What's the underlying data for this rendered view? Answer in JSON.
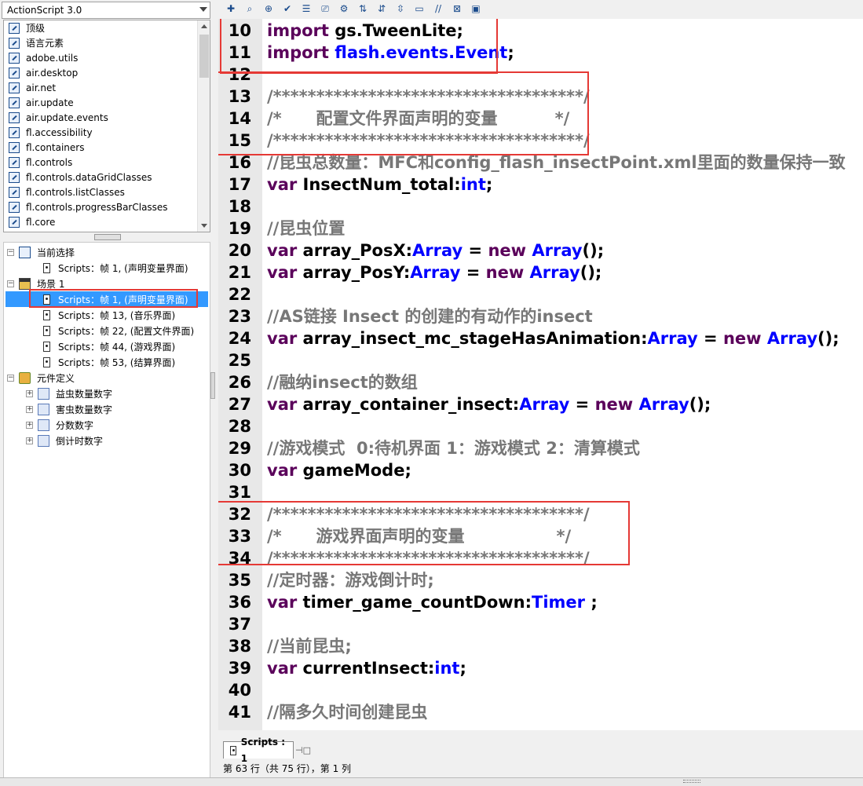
{
  "left_panel": {
    "dropdown_value": "ActionScript 3.0",
    "library_items": [
      "顶级",
      "语言元素",
      "adobe.utils",
      "air.desktop",
      "air.net",
      "air.update",
      "air.update.events",
      "fl.accessibility",
      "fl.containers",
      "fl.controls",
      "fl.controls.dataGridClasses",
      "fl.controls.listClasses",
      "fl.controls.progressBarClasses",
      "fl.core"
    ],
    "tree": {
      "current_selection": "当前选择",
      "current_script": "Scripts：帧 1, (声明变量界面)",
      "scene": "场景 1",
      "scene_scripts": [
        "Scripts：帧 1, (声明变量界面)",
        "Scripts：帧 13, (音乐界面)",
        "Scripts：帧 22, (配置文件界面)",
        "Scripts：帧 44, (游戏界面)",
        "Scripts：帧 53, (结算界面)"
      ],
      "symbol_definitions": "元件定义",
      "symbols": [
        "益虫数量数字",
        "害虫数量数字",
        "分数数字",
        "倒计时数字"
      ]
    }
  },
  "toolbar": {
    "icons": [
      "add-script-icon",
      "find-icon",
      "target-icon",
      "check-syntax-icon",
      "auto-format-icon",
      "code-hint-icon",
      "debug-icon",
      "collapse-icon",
      "collapse-selection-icon",
      "expand-icon",
      "block-comment-icon",
      "line-comment-icon",
      "remove-comment-icon",
      "show-toolbox-icon"
    ]
  },
  "editor": {
    "lines": [
      {
        "n": "10",
        "tokens": [
          [
            "kw",
            "import "
          ],
          [
            "id",
            "gs.TweenLite;"
          ]
        ]
      },
      {
        "n": "11",
        "tokens": [
          [
            "kw",
            "import "
          ],
          [
            "ty",
            "flash.events.Event"
          ],
          [
            "id",
            ";"
          ]
        ]
      },
      {
        "n": "12",
        "tokens": []
      },
      {
        "n": "13",
        "tokens": [
          [
            "cm",
            "/************************************/"
          ]
        ]
      },
      {
        "n": "14",
        "tokens": [
          [
            "cm",
            "/*      配置文件界面声明的变量          */"
          ]
        ]
      },
      {
        "n": "15",
        "tokens": [
          [
            "cm",
            "/************************************/"
          ]
        ]
      },
      {
        "n": "16",
        "tokens": [
          [
            "cm",
            "//昆虫总数量：MFC和config_flash_insectPoint.xml里面的数量保持一致"
          ]
        ]
      },
      {
        "n": "17",
        "tokens": [
          [
            "kw",
            "var "
          ],
          [
            "id",
            "InsectNum_total:"
          ],
          [
            "ty",
            "int"
          ],
          [
            "id",
            ";"
          ]
        ]
      },
      {
        "n": "18",
        "tokens": []
      },
      {
        "n": "19",
        "tokens": [
          [
            "cm",
            "//昆虫位置"
          ]
        ]
      },
      {
        "n": "20",
        "tokens": [
          [
            "kw",
            "var "
          ],
          [
            "id",
            "array_PosX:"
          ],
          [
            "ty",
            "Array"
          ],
          [
            "id",
            " = "
          ],
          [
            "kw",
            "new "
          ],
          [
            "ty",
            "Array"
          ],
          [
            "id",
            "();"
          ]
        ]
      },
      {
        "n": "21",
        "tokens": [
          [
            "kw",
            "var "
          ],
          [
            "id",
            "array_PosY:"
          ],
          [
            "ty",
            "Array"
          ],
          [
            "id",
            " = "
          ],
          [
            "kw",
            "new "
          ],
          [
            "ty",
            "Array"
          ],
          [
            "id",
            "();"
          ]
        ]
      },
      {
        "n": "22",
        "tokens": []
      },
      {
        "n": "23",
        "tokens": [
          [
            "cm",
            "//AS链接 Insect 的创建的有动作的insect"
          ]
        ]
      },
      {
        "n": "24",
        "tokens": [
          [
            "kw",
            "var "
          ],
          [
            "id",
            "array_insect_mc_stageHasAnimation:"
          ],
          [
            "ty",
            "Array"
          ],
          [
            "id",
            " = "
          ],
          [
            "kw",
            "new "
          ],
          [
            "ty",
            "Array"
          ],
          [
            "id",
            "();"
          ]
        ]
      },
      {
        "n": "25",
        "tokens": []
      },
      {
        "n": "26",
        "tokens": [
          [
            "cm",
            "//融纳insect的数组"
          ]
        ]
      },
      {
        "n": "27",
        "tokens": [
          [
            "kw",
            "var "
          ],
          [
            "id",
            "array_container_insect:"
          ],
          [
            "ty",
            "Array"
          ],
          [
            "id",
            " = "
          ],
          [
            "kw",
            "new "
          ],
          [
            "ty",
            "Array"
          ],
          [
            "id",
            "();"
          ]
        ]
      },
      {
        "n": "28",
        "tokens": []
      },
      {
        "n": "29",
        "tokens": [
          [
            "cm",
            "//游戏模式  0:待机界面 1：游戏模式 2：清算模式"
          ]
        ]
      },
      {
        "n": "30",
        "tokens": [
          [
            "kw",
            "var "
          ],
          [
            "id",
            "gameMode;"
          ]
        ]
      },
      {
        "n": "31",
        "tokens": []
      },
      {
        "n": "32",
        "tokens": [
          [
            "cm",
            "/************************************/"
          ]
        ]
      },
      {
        "n": "33",
        "tokens": [
          [
            "cm",
            "/*      游戏界面声明的变量                */"
          ]
        ]
      },
      {
        "n": "34",
        "tokens": [
          [
            "cm",
            "/************************************/"
          ]
        ]
      },
      {
        "n": "35",
        "tokens": [
          [
            "cm",
            "//定时器：游戏倒计时;"
          ]
        ]
      },
      {
        "n": "36",
        "tokens": [
          [
            "kw",
            "var "
          ],
          [
            "id",
            "timer_game_countDown:"
          ],
          [
            "ty",
            "Timer"
          ],
          [
            "id",
            " ;"
          ]
        ]
      },
      {
        "n": "37",
        "tokens": []
      },
      {
        "n": "38",
        "tokens": [
          [
            "cm",
            "//当前昆虫;"
          ]
        ]
      },
      {
        "n": "39",
        "tokens": [
          [
            "kw",
            "var "
          ],
          [
            "id",
            "currentInsect:"
          ],
          [
            "ty",
            "int"
          ],
          [
            "id",
            ";"
          ]
        ]
      },
      {
        "n": "40",
        "tokens": []
      },
      {
        "n": "41",
        "tokens": [
          [
            "cm",
            "//隔多久时间创建昆虫"
          ]
        ]
      }
    ]
  },
  "tab": {
    "label": "Scripts : 1"
  },
  "status": "第 63 行（共 75 行），第 1 列"
}
